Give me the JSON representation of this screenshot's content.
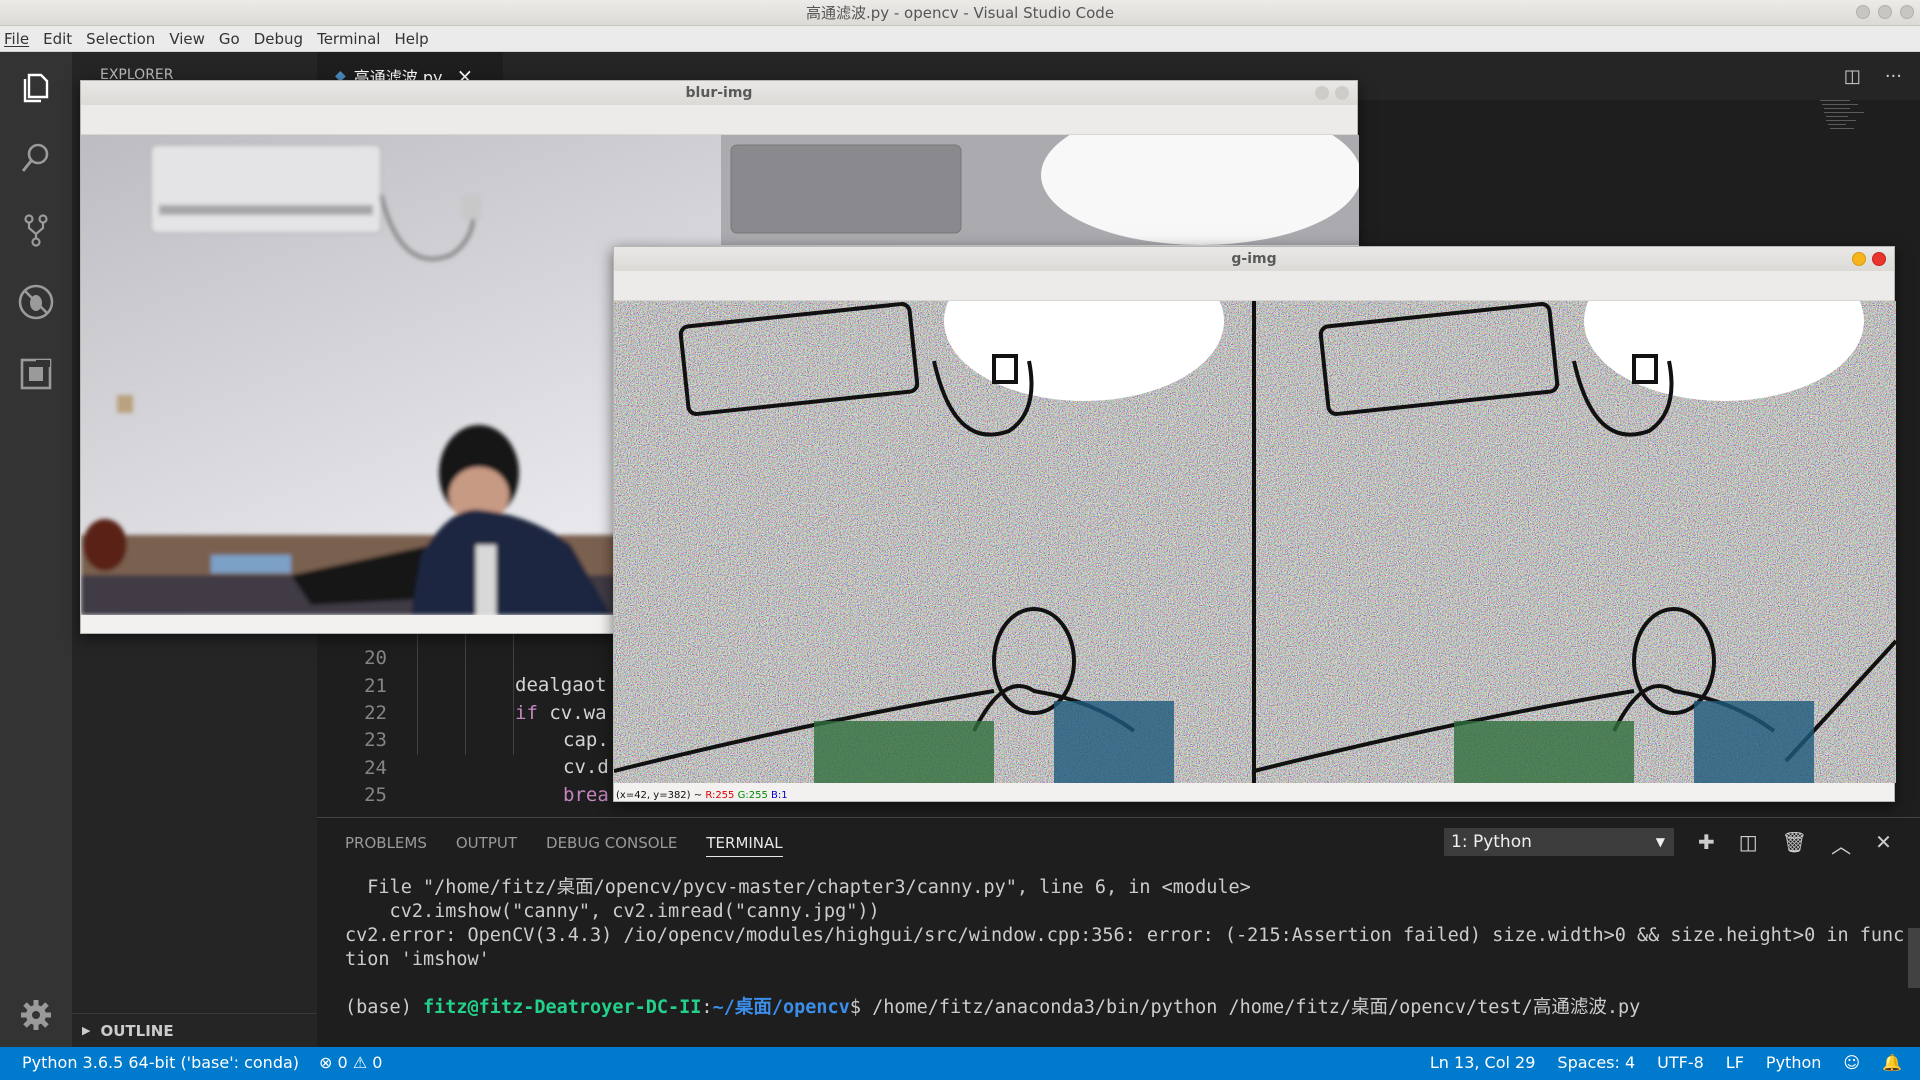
{
  "window": {
    "title": "高通滤波.py - opencv - Visual Studio Code"
  },
  "menu": [
    "File",
    "Edit",
    "Selection",
    "View",
    "Go",
    "Debug",
    "Terminal",
    "Help"
  ],
  "sidebar": {
    "header": "EXPLORER",
    "outline": "OUTLINE"
  },
  "editor": {
    "tab": {
      "label": "高通滤波.py",
      "close": "×"
    },
    "lines": [
      {
        "num": "20",
        "code": "dealgaot"
      },
      {
        "num": "21",
        "kw": "if",
        "code": " cv.wa"
      },
      {
        "num": "22",
        "code": "cap."
      },
      {
        "num": "23",
        "code": "cv.d"
      },
      {
        "num": "24",
        "kw": "brea",
        "code": ""
      },
      {
        "num": "25",
        "code": ""
      }
    ]
  },
  "blur_window": {
    "title": "blur-img"
  },
  "g_window": {
    "title": "g-img",
    "coords": "(x=42, y=382) ~ ",
    "r": "R:255",
    "g": "G:255",
    "b": "B:1"
  },
  "panel": {
    "tabs": [
      "PROBLEMS",
      "OUTPUT",
      "DEBUG CONSOLE",
      "TERMINAL"
    ],
    "active_tab": "TERMINAL",
    "terminal_select": "1: Python",
    "terminal": {
      "line1": "  File \"/home/fitz/桌面/opencv/pycv-master/chapter3/canny.py\", line 6, in <module>",
      "line2": "    cv2.imshow(\"canny\", cv2.imread(\"canny.jpg\"))",
      "line3": "cv2.error: OpenCV(3.4.3) /io/opencv/modules/highgui/src/window.cpp:356: error: (-215:Assertion failed) size.width>0 && size.height>0 in func",
      "line4": "tion 'imshow'",
      "prompt_env": "(base) ",
      "prompt_user": "fitz@fitz-Deatroyer-DC-II",
      "prompt_colon": ":",
      "prompt_path": "~/桌面/opencv",
      "prompt_cmd": "$ /home/fitz/anaconda3/bin/python /home/fitz/桌面/opencv/test/高通滤波.py"
    }
  },
  "statusbar": {
    "interpreter": "Python 3.6.5 64-bit ('base': conda)",
    "errors": "0",
    "warnings": "0",
    "position": "Ln 13, Col 29",
    "spaces": "Spaces: 4",
    "encoding": "UTF-8",
    "eol": "LF",
    "language": "Python"
  },
  "colors": {
    "accent": "#007acc",
    "activity": "#333333",
    "sidebar": "#252526"
  }
}
